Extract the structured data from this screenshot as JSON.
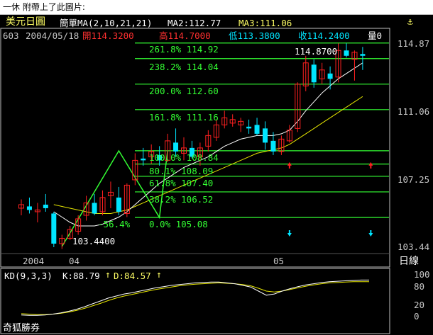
{
  "caption": "一休 附帶上了此圖片:",
  "header": {
    "title": "美元日圓",
    "ma_label": "簡單MA(2,10,21,21)",
    "ma2": "MA2:112.77",
    "ma3": "MA3:111.06",
    "code": "603",
    "date": "2004/05/18",
    "open": "開114.3200",
    "high": "高114.7000",
    "low": "低113.3800",
    "close": "收114.2400",
    "volume": "量0"
  },
  "colors": {
    "background": "#000000",
    "up_candle": "#ff2020",
    "down_candle": "#00e5ff",
    "fib_lines": "#33ff33",
    "ma_fast": "#ffffff",
    "ma_slow": "#e6e600",
    "axis": "#c0c0c0",
    "header_yellow": "#ffff66",
    "header_cyan": "#00e5ff",
    "header_red": "#ff3030"
  },
  "icons": {
    "settings": "lamp-icon",
    "up_arrow": "up-arrow-icon",
    "down_arrow": "down-arrow-icon"
  },
  "right_axis": {
    "ticks": [
      "114.87",
      "111.06",
      "107.25",
      "103.44"
    ],
    "period_button": "日線"
  },
  "x_axis": {
    "labels": [
      "2004",
      "04",
      "05"
    ]
  },
  "fibonacci": [
    {
      "label": "261.8% 114.92",
      "price": 114.92
    },
    {
      "label": "238.2% 114.04",
      "price": 114.04
    },
    {
      "label": "200.0% 112.60",
      "price": 112.6
    },
    {
      "label": "161.8% 111.16",
      "price": 111.16
    },
    {
      "label": "100.0% 108.84",
      "price": 108.84
    },
    {
      "label": "80.1% 108.09",
      "price": 108.09
    },
    {
      "label": "61.8% 107.40",
      "price": 107.4
    },
    {
      "label": "38.2% 106.52",
      "price": 106.52
    },
    {
      "label": "0.0% 105.08",
      "price": 105.08
    }
  ],
  "annotations": {
    "low_price": "103.4400",
    "high_price": "114.8700",
    "swing_percent": "-56.4%"
  },
  "kd": {
    "label": "KD(9,3,3)",
    "k": "K:88.79",
    "d": "D:84.57",
    "ticks": [
      "100",
      "80",
      "20",
      "0"
    ],
    "k_values": [
      4,
      3,
      3,
      4,
      6,
      9,
      13,
      18,
      24,
      31,
      38,
      45,
      50,
      55,
      58,
      62,
      66,
      70,
      73,
      76,
      78,
      80,
      82,
      83,
      84,
      84,
      82,
      80,
      76,
      72,
      62,
      52,
      55,
      62,
      68,
      73,
      77,
      80,
      83,
      85,
      86,
      87,
      88,
      89,
      89
    ],
    "d_values": [
      7,
      6,
      5,
      5,
      6,
      8,
      11,
      15,
      20,
      26,
      32,
      39,
      45,
      50,
      54,
      58,
      62,
      66,
      69,
      72,
      75,
      77,
      79,
      80,
      81,
      82,
      81,
      80,
      78,
      75,
      69,
      62,
      60,
      62,
      66,
      70,
      74,
      77,
      80,
      82,
      83,
      84,
      85,
      85,
      85
    ]
  },
  "footer": {
    "brand": "奇狐勝券"
  },
  "chart_data": {
    "type": "candlestick",
    "y_axis_range": [
      103.2,
      115.3
    ],
    "x_axis_labels": [
      "2004",
      "04",
      "05"
    ],
    "candles": [
      {
        "o": 105.6,
        "h": 106.1,
        "l": 105.2,
        "c": 105.8
      },
      {
        "o": 105.7,
        "h": 106.2,
        "l": 105.3,
        "c": 105.5
      },
      {
        "o": 105.4,
        "h": 105.9,
        "l": 104.8,
        "c": 105.5
      },
      {
        "o": 105.8,
        "h": 106.4,
        "l": 105.4,
        "c": 105.6
      },
      {
        "o": 105.3,
        "h": 105.4,
        "l": 103.4,
        "c": 103.6
      },
      {
        "o": 103.6,
        "h": 104.1,
        "l": 103.3,
        "c": 103.9
      },
      {
        "o": 103.9,
        "h": 104.6,
        "l": 103.8,
        "c": 104.4
      },
      {
        "o": 104.3,
        "h": 105.2,
        "l": 104.1,
        "c": 105.0
      },
      {
        "o": 105.2,
        "h": 106.3,
        "l": 104.9,
        "c": 105.9
      },
      {
        "o": 105.9,
        "h": 106.4,
        "l": 105.2,
        "c": 105.3
      },
      {
        "o": 105.4,
        "h": 106.6,
        "l": 105.2,
        "c": 106.2
      },
      {
        "o": 106.3,
        "h": 107.1,
        "l": 105.6,
        "c": 106.5
      },
      {
        "o": 106.2,
        "h": 106.8,
        "l": 105.2,
        "c": 105.4
      },
      {
        "o": 105.3,
        "h": 107.0,
        "l": 105.1,
        "c": 106.9
      },
      {
        "o": 107.2,
        "h": 108.7,
        "l": 106.9,
        "c": 108.3
      },
      {
        "o": 108.4,
        "h": 109.0,
        "l": 108.0,
        "c": 108.3
      },
      {
        "o": 108.5,
        "h": 109.2,
        "l": 108.1,
        "c": 108.8
      },
      {
        "o": 108.6,
        "h": 109.1,
        "l": 108.0,
        "c": 108.3
      },
      {
        "o": 108.3,
        "h": 109.8,
        "l": 108.2,
        "c": 109.4
      },
      {
        "o": 109.3,
        "h": 110.1,
        "l": 108.5,
        "c": 108.8
      },
      {
        "o": 108.7,
        "h": 109.6,
        "l": 108.3,
        "c": 109.0
      },
      {
        "o": 109.0,
        "h": 109.4,
        "l": 108.4,
        "c": 108.5
      },
      {
        "o": 108.5,
        "h": 109.3,
        "l": 108.0,
        "c": 109.0
      },
      {
        "o": 109.1,
        "h": 110.0,
        "l": 108.8,
        "c": 109.7
      },
      {
        "o": 109.6,
        "h": 110.6,
        "l": 109.4,
        "c": 110.3
      },
      {
        "o": 110.3,
        "h": 111.1,
        "l": 110.1,
        "c": 110.7
      },
      {
        "o": 110.4,
        "h": 110.9,
        "l": 110.2,
        "c": 110.6
      },
      {
        "o": 110.3,
        "h": 110.7,
        "l": 109.9,
        "c": 110.5
      },
      {
        "o": 110.2,
        "h": 110.6,
        "l": 109.8,
        "c": 110.1
      },
      {
        "o": 110.3,
        "h": 110.7,
        "l": 109.7,
        "c": 109.8
      },
      {
        "o": 110.1,
        "h": 110.5,
        "l": 108.9,
        "c": 109.3
      },
      {
        "o": 109.4,
        "h": 109.9,
        "l": 108.6,
        "c": 108.8
      },
      {
        "o": 108.8,
        "h": 109.7,
        "l": 108.6,
        "c": 109.5
      },
      {
        "o": 109.4,
        "h": 110.3,
        "l": 109.3,
        "c": 110.0
      },
      {
        "o": 110.1,
        "h": 112.7,
        "l": 109.9,
        "c": 112.6
      },
      {
        "o": 112.5,
        "h": 114.2,
        "l": 112.2,
        "c": 113.8
      },
      {
        "o": 113.7,
        "h": 114.0,
        "l": 112.4,
        "c": 112.7
      },
      {
        "o": 112.9,
        "h": 113.8,
        "l": 112.6,
        "c": 113.4
      },
      {
        "o": 113.2,
        "h": 113.6,
        "l": 112.3,
        "c": 112.9
      },
      {
        "o": 113.0,
        "h": 114.9,
        "l": 112.7,
        "c": 114.5
      },
      {
        "o": 114.5,
        "h": 114.9,
        "l": 114.1,
        "c": 114.2
      },
      {
        "o": 114.0,
        "h": 114.5,
        "l": 112.8,
        "c": 114.4
      },
      {
        "o": 114.3,
        "h": 114.7,
        "l": 113.4,
        "c": 114.2
      }
    ],
    "ma_fast": [
      null,
      null,
      null,
      null,
      105.4,
      105.1,
      104.8,
      104.6,
      104.6,
      104.6,
      104.7,
      104.9,
      105.1,
      105.4,
      105.8,
      106.2,
      106.6,
      107.0,
      107.3,
      107.6,
      107.9,
      108.1,
      108.3,
      108.5,
      108.8,
      109.1,
      109.3,
      109.5,
      109.6,
      109.7,
      109.7,
      109.7,
      109.8,
      110.0,
      110.5,
      111.1,
      111.6,
      112.1,
      112.5,
      112.9,
      113.2,
      113.5,
      113.8
    ],
    "ma_slow": [
      null,
      null,
      null,
      null,
      105.8,
      105.7,
      105.6,
      105.5,
      105.4,
      105.3,
      105.3,
      105.3,
      105.4,
      105.5,
      105.7,
      105.9,
      106.1,
      106.3,
      106.5,
      106.7,
      106.9,
      107.1,
      107.3,
      107.5,
      107.7,
      107.9,
      108.1,
      108.3,
      108.5,
      108.7,
      108.8,
      108.9,
      109.0,
      109.2,
      109.5,
      109.8,
      110.1,
      110.4,
      110.7,
      111.0,
      111.3,
      111.6,
      111.9
    ],
    "zigzag": [
      {
        "i": 5,
        "p": 103.44
      },
      {
        "i": 12,
        "p": 108.84
      },
      {
        "i": 17,
        "p": 105.08
      },
      {
        "i": 18,
        "p": 108.84
      }
    ],
    "markers": [
      {
        "i": 33,
        "price": 108.0,
        "dir": "up",
        "color": "#ff2020"
      },
      {
        "i": 43,
        "price": 108.0,
        "dir": "up",
        "color": "#ff2020"
      },
      {
        "i": 33,
        "price": 104.2,
        "dir": "down",
        "color": "#00e5ff"
      },
      {
        "i": 43,
        "price": 104.2,
        "dir": "down",
        "color": "#00e5ff"
      }
    ]
  }
}
